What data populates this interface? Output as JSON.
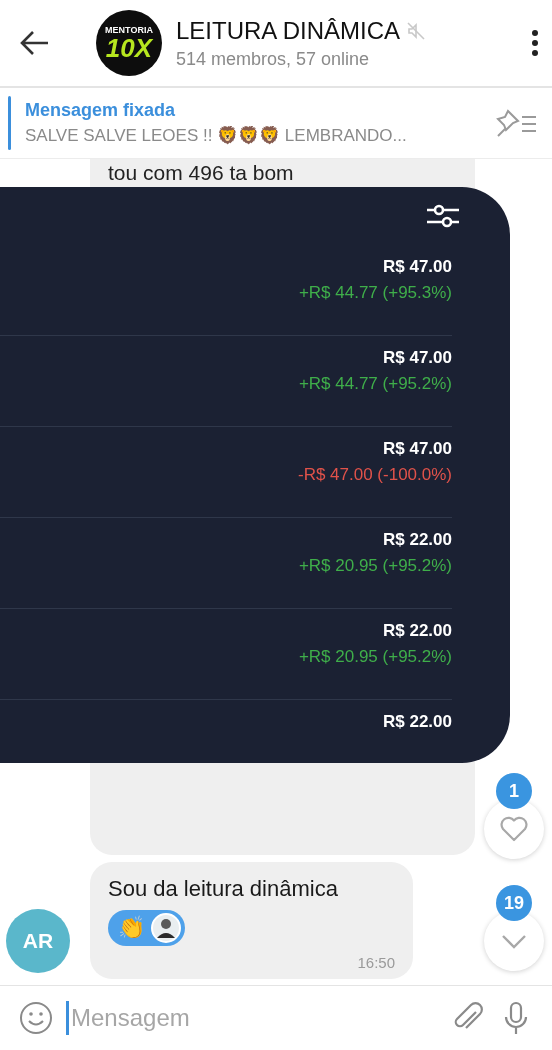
{
  "header": {
    "logo": [
      "MENTORIA",
      "10X"
    ],
    "title": "LEITURA DINÂMICA",
    "muted": true,
    "subtitle": "514 membros, 57 online"
  },
  "pinned": {
    "title": "Mensagem fixada",
    "text": "SALVE SALVE LEOES !! 🦁🦁🦁 LEMBRANDO..."
  },
  "messages": [
    {
      "kind": "image",
      "caption": "tou com 496 ta bom",
      "rows": [
        {
          "price": "R$ 47.00",
          "change": "+R$ 44.77 (+95.3%)",
          "color": "#3fae4a"
        },
        {
          "price": "R$ 47.00",
          "change": "+R$ 44.77 (+95.2%)",
          "color": "#3fae4a"
        },
        {
          "price": "R$ 47.00",
          "change": "-R$ 47.00 (-100.0%)",
          "color": "#e0524a"
        },
        {
          "price": "R$ 22.00",
          "change": "+R$ 20.95 (+95.2%)",
          "color": "#3fae4a"
        },
        {
          "price": "R$ 22.00",
          "change": "+R$ 20.95 (+95.2%)",
          "color": "#3fae4a"
        },
        {
          "price": "R$ 22.00"
        }
      ]
    },
    {
      "kind": "text",
      "sender_initials": "AR",
      "text": "Sou da leitura dinâmica",
      "reactions": [
        {
          "emoji": "👏",
          "selected": true
        }
      ],
      "time": "16:50"
    }
  ],
  "floating_buttons": [
    {
      "kind": "reactions",
      "count": "1"
    },
    {
      "kind": "scroll_down",
      "count": "19"
    }
  ],
  "composer": {
    "placeholder": "Mensagem"
  }
}
